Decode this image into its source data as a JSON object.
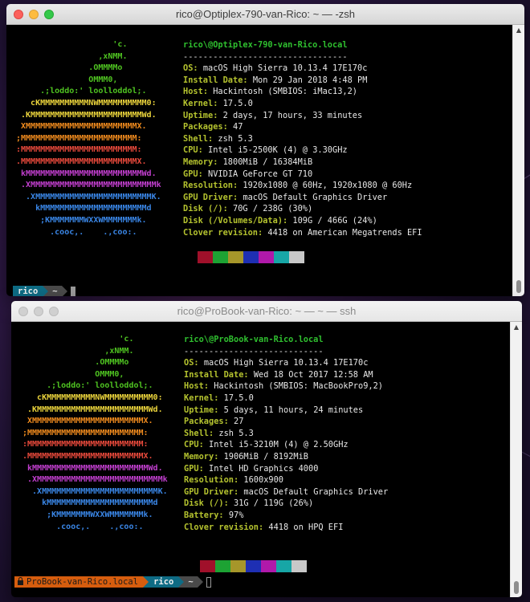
{
  "colors": {
    "label": "#b5c32f",
    "header": "#2fc02f",
    "value": "#e8e8e8",
    "logo": [
      "#4fc321",
      "#4fc321",
      "#4fc321",
      "#4fc321",
      "#4fc321",
      "#ebd43c",
      "#ebd43c",
      "#f08b1e",
      "#f08b1e",
      "#ea4a3c",
      "#ea4a3c",
      "#c23fcf",
      "#c23fcf",
      "#3a86e6",
      "#3a86e6",
      "#3a86e6"
    ],
    "swatches": [
      "#a0102a",
      "#1da233",
      "#a6962a",
      "#1e2fb3",
      "#b019aa",
      "#17a6a6",
      "#c8c8c8"
    ]
  },
  "window1": {
    "title": "rico@Optiplex-790-van-Rico: ~ — -zsh",
    "logo": [
      "                    'c.",
      "                 ,xNMM.",
      "               .OMMMMo",
      "               OMMM0,",
      "     .;loddo:' loolloddol;.",
      "   cKMMMMMMMMMMNWMMMMMMMMMM0:",
      " .KMMMMMMMMMMMMMMMMMMMMMMMWd.",
      " XMMMMMMMMMMMMMMMMMMMMMMMX.",
      ";MMMMMMMMMMMMMMMMMMMMMMMM:",
      ":MMMMMMMMMMMMMMMMMMMMMMMM:",
      ".MMMMMMMMMMMMMMMMMMMMMMMMX.",
      " kMMMMMMMMMMMMMMMMMMMMMMMMWd.",
      " .XMMMMMMMMMMMMMMMMMMMMMMMMMMk",
      "  .XMMMMMMMMMMMMMMMMMMMMMMMMK.",
      "    kMMMMMMMMMMMMMMMMMMMMMMd",
      "     ;KMMMMMMMWXXWMMMMMMMk.",
      "       .cooc,.    .,coo:."
    ],
    "header": "rico\\@Optiplex-790-van-Rico.local",
    "separator": "---------------------------------",
    "info": [
      {
        "label": "OS",
        "value": "macOS High Sierra 10.13.4 17E170c"
      },
      {
        "label": "Install Date",
        "value": "Mon 29 Jan 2018 4:48 PM"
      },
      {
        "label": "Host",
        "value": "Hackintosh (SMBIOS: iMac13,2)"
      },
      {
        "label": "Kernel",
        "value": "17.5.0"
      },
      {
        "label": "Uptime",
        "value": "2 days, 17 hours, 33 minutes"
      },
      {
        "label": "Packages",
        "value": "47"
      },
      {
        "label": "Shell",
        "value": "zsh 5.3"
      },
      {
        "label": "CPU",
        "value": "Intel i5-2500K (4) @ 3.30GHz"
      },
      {
        "label": "Memory",
        "value": "1800MiB / 16384MiB"
      },
      {
        "label": "GPU",
        "value": "NVIDIA GeForce GT 710"
      },
      {
        "label": "Resolution",
        "value": "1920x1080 @ 60Hz, 1920x1080 @ 60Hz"
      },
      {
        "label": "GPU Driver",
        "value": "macOS Default Graphics Driver"
      },
      {
        "label": "Disk (/)",
        "value": "70G / 238G (30%)"
      },
      {
        "label": "Disk (/Volumes/Data)",
        "value": "109G / 466G (24%)"
      },
      {
        "label": "Clover revision",
        "value": "4418 on American Megatrends EFI"
      }
    ],
    "prompt": {
      "user": "rico",
      "dir": "~"
    }
  },
  "window2": {
    "title": "rico@ProBook-van-Rico: ~ — ~ — ssh",
    "logo": [
      "                    'c.",
      "                 ,xNMM.",
      "               .OMMMMo",
      "               OMMM0,",
      "     .;loddo:' loolloddol;.",
      "   cKMMMMMMMMMMNWMMMMMMMMMM0:",
      " .KMMMMMMMMMMMMMMMMMMMMMMMWd.",
      " XMMMMMMMMMMMMMMMMMMMMMMMX.",
      ";MMMMMMMMMMMMMMMMMMMMMMMM:",
      ":MMMMMMMMMMMMMMMMMMMMMMMM:",
      ".MMMMMMMMMMMMMMMMMMMMMMMMX.",
      " kMMMMMMMMMMMMMMMMMMMMMMMMWd.",
      " .XMMMMMMMMMMMMMMMMMMMMMMMMMMk",
      "  .XMMMMMMMMMMMMMMMMMMMMMMMMK.",
      "    kMMMMMMMMMMMMMMMMMMMMMMd",
      "     ;KMMMMMMMWXXWMMMMMMMk.",
      "       .cooc,.    .,coo:."
    ],
    "header": "rico\\@ProBook-van-Rico.local",
    "separator": "----------------------------",
    "info": [
      {
        "label": "OS",
        "value": "macOS High Sierra 10.13.4 17E170c"
      },
      {
        "label": "Install Date",
        "value": "Wed 18 Oct 2017 12:58 AM"
      },
      {
        "label": "Host",
        "value": "Hackintosh (SMBIOS: MacBookPro9,2)"
      },
      {
        "label": "Kernel",
        "value": "17.5.0"
      },
      {
        "label": "Uptime",
        "value": "5 days, 11 hours, 24 minutes"
      },
      {
        "label": "Packages",
        "value": "27"
      },
      {
        "label": "Shell",
        "value": "zsh 5.3"
      },
      {
        "label": "CPU",
        "value": "Intel i5-3210M (4) @ 2.50GHz"
      },
      {
        "label": "Memory",
        "value": "1906MiB / 8192MiB"
      },
      {
        "label": "GPU",
        "value": "Intel HD Graphics 4000"
      },
      {
        "label": "Resolution",
        "value": "1600x900"
      },
      {
        "label": "GPU Driver",
        "value": "macOS Default Graphics Driver"
      },
      {
        "label": "Disk (/)",
        "value": "31G / 119G (26%)"
      },
      {
        "label": "Battery",
        "value": "97%"
      },
      {
        "label": "Clover revision",
        "value": "4418 on HPQ EFI"
      }
    ],
    "prompt": {
      "host": "ProBook-van-Rico.local",
      "user": "rico",
      "dir": "~"
    }
  }
}
